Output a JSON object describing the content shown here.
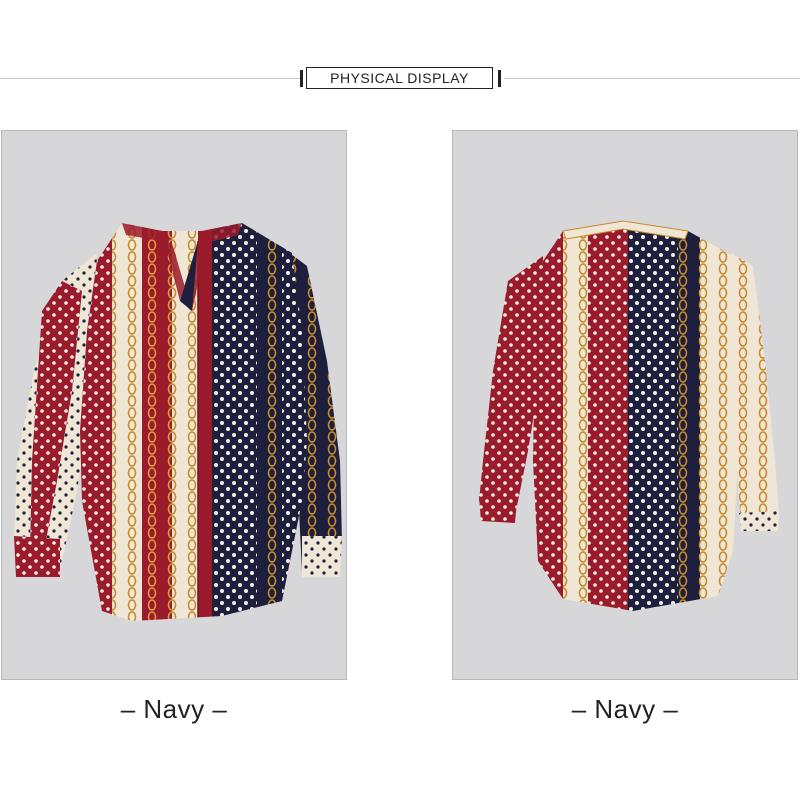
{
  "header": {
    "title": "PHYSICAL DISPLAY"
  },
  "views": [
    {
      "caption": "– Navy –",
      "side": "front-view"
    },
    {
      "caption": "– Navy –",
      "side": "back-view"
    }
  ],
  "colors": {
    "panel_bg": "#d7d7d9",
    "red": "#9a1b2c",
    "navy": "#1d1f3d",
    "cream": "#efe6d6",
    "gold": "#c88a2a"
  }
}
